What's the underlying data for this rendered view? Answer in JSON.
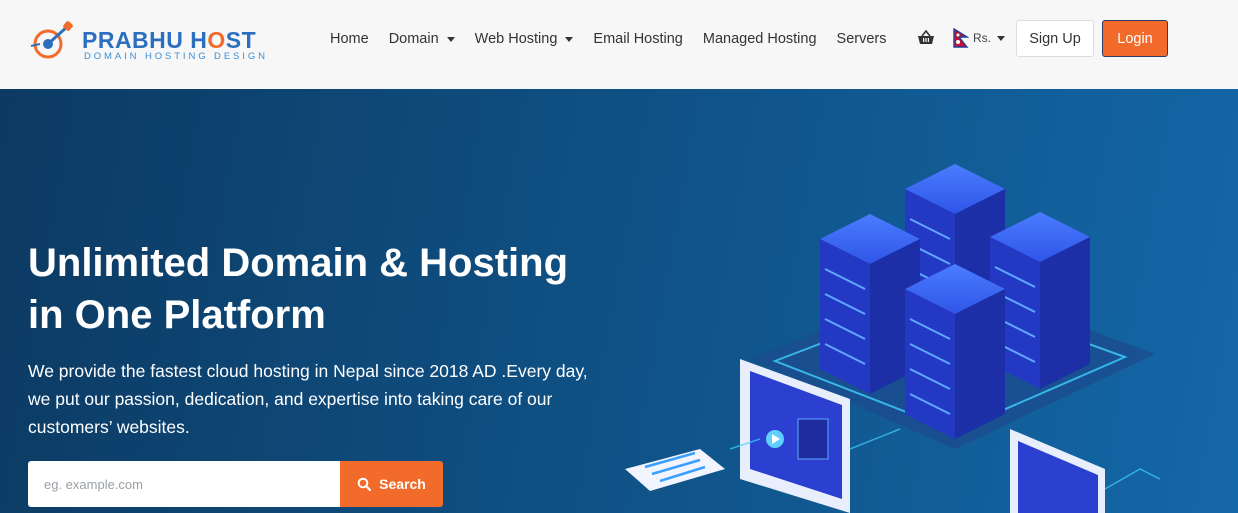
{
  "brand": {
    "name_prefix": "PRABHU H",
    "name_o": "O",
    "name_suffix": "ST",
    "tagline": "DOMAIN HOSTING DESIGN"
  },
  "nav": {
    "items": [
      {
        "label": "Home"
      },
      {
        "label": "Domain"
      },
      {
        "label": "Web Hosting"
      },
      {
        "label": "Email Hosting"
      },
      {
        "label": "Managed Hosting"
      },
      {
        "label": "Servers"
      }
    ]
  },
  "header": {
    "cart_icon": "basket-icon",
    "currency_label": "Rs.",
    "signup_label": "Sign Up",
    "login_label": "Login"
  },
  "hero": {
    "title": "Unlimited Domain & Hosting in One Platform",
    "description": "We provide the fastest cloud hosting in Nepal since 2018 AD .Every day, we put our passion, dedication, and expertise into taking care of our customers’ websites.",
    "search_placeholder": "eg. example.com",
    "search_value": "",
    "search_button_label": "Search"
  },
  "colors": {
    "accent": "#f26b2a",
    "brand_blue": "#2c6fbf",
    "hero_dark": "#0c3a62",
    "hero_light": "#1467a8"
  }
}
